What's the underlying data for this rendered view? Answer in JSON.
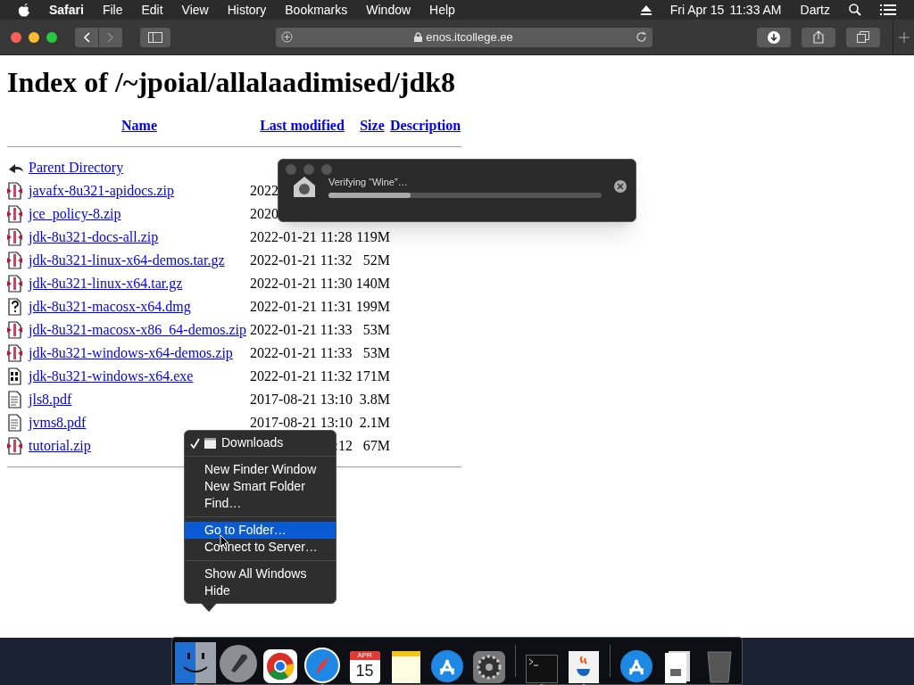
{
  "menu_bar": {
    "app": "Safari",
    "items": [
      "File",
      "Edit",
      "View",
      "History",
      "Bookmarks",
      "Window",
      "Help"
    ],
    "date": "Fri Apr 15",
    "time": "11:33 AM",
    "user": "Dartz"
  },
  "toolbar": {
    "back_disabled": false,
    "forward_disabled": true,
    "address": "enos.itcollege.ee"
  },
  "page": {
    "title": "Index of /~jpoial/allalaadimised/jdk8",
    "columns": [
      "Name",
      "Last modified",
      "Size",
      "Description"
    ],
    "rows": [
      {
        "kind": "back",
        "name": "Parent Directory",
        "modified": "",
        "size": ""
      },
      {
        "kind": "archive",
        "name": "javafx-8u321-apidocs.zip",
        "modified": "2022",
        "size": "",
        "clipped_left": false
      },
      {
        "kind": "archive",
        "name": "jce_policy-8.zip",
        "modified": "2020",
        "size": "",
        "clipped_left": false
      },
      {
        "kind": "archive",
        "name": "jdk-8u321-docs-all.zip",
        "modified": "2022-01-21 11:28",
        "size": "119M"
      },
      {
        "kind": "archive",
        "name": "jdk-8u321-linux-x64-demos.tar.gz",
        "modified": "2022-01-21 11:32",
        "size": "52M"
      },
      {
        "kind": "archive",
        "name": "jdk-8u321-linux-x64.tar.gz",
        "modified": "2022-01-21 11:30",
        "size": "140M"
      },
      {
        "kind": "unknown",
        "name": "jdk-8u321-macosx-x64.dmg",
        "modified": "2022-01-21 11:31",
        "size": "199M"
      },
      {
        "kind": "archive",
        "name": "jdk-8u321-macosx-x86_64-demos.zip",
        "modified": "2022-01-21 11:33",
        "size": "53M"
      },
      {
        "kind": "archive",
        "name": "jdk-8u321-windows-x64-demos.zip",
        "modified": "2022-01-21 11:33",
        "size": "53M"
      },
      {
        "kind": "binary",
        "name": "jdk-8u321-windows-x64.exe",
        "modified": "2022-01-21 11:32",
        "size": "171M"
      },
      {
        "kind": "text",
        "name": "jls8.pdf",
        "modified": "2017-08-21 13:10",
        "size": "3.8M"
      },
      {
        "kind": "text",
        "name": "jvms8.pdf",
        "modified": "2017-08-21 13:10",
        "size": "2.1M"
      },
      {
        "kind": "archive",
        "name": "tutorial.zip",
        "modified": ":12",
        "size": "67M",
        "clipped_left": true
      }
    ]
  },
  "dialog": {
    "title": "Verifying “Wine”…",
    "level": 0.3
  },
  "context_menu": {
    "groups": [
      [
        {
          "label": "Downloads",
          "checked": true,
          "selected": false
        }
      ],
      [
        {
          "label": "New Finder Window",
          "checked": false,
          "selected": false
        },
        {
          "label": "New Smart Folder",
          "checked": false,
          "selected": false
        },
        {
          "label": "Find…",
          "checked": false,
          "selected": false
        }
      ],
      [
        {
          "label": "Go to Folder…",
          "checked": false,
          "selected": true
        },
        {
          "label": "Connect to Server…",
          "checked": false,
          "selected": false
        }
      ],
      [
        {
          "label": "Show All Windows",
          "checked": false,
          "selected": false
        },
        {
          "label": "Hide",
          "checked": false,
          "selected": false
        }
      ]
    ]
  },
  "dock": {
    "items": [
      {
        "kind": "finder",
        "running": true
      },
      {
        "kind": "launchpad",
        "running": false
      },
      {
        "kind": "chrome",
        "running": false
      },
      {
        "kind": "safari",
        "running": true
      },
      {
        "kind": "calendar",
        "running": false,
        "month": "APR",
        "day": "15"
      },
      {
        "kind": "notes",
        "running": false
      },
      {
        "kind": "appstore",
        "running": false
      },
      {
        "kind": "settings",
        "running": false
      },
      {
        "kind": "divider"
      },
      {
        "kind": "terminal",
        "running": true
      },
      {
        "kind": "java",
        "running": true
      },
      {
        "kind": "divider"
      },
      {
        "kind": "appstore",
        "running": false
      },
      {
        "kind": "files",
        "running": false
      },
      {
        "kind": "trash",
        "running": false
      }
    ]
  }
}
